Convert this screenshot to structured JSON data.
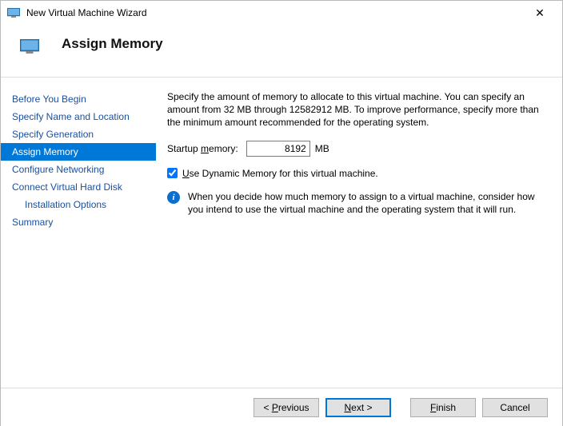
{
  "window": {
    "title": "New Virtual Machine Wizard"
  },
  "header": {
    "title": "Assign Memory"
  },
  "sidebar": {
    "items": [
      {
        "label": "Before You Begin",
        "active": false,
        "sub": false
      },
      {
        "label": "Specify Name and Location",
        "active": false,
        "sub": false
      },
      {
        "label": "Specify Generation",
        "active": false,
        "sub": false
      },
      {
        "label": "Assign Memory",
        "active": true,
        "sub": false
      },
      {
        "label": "Configure Networking",
        "active": false,
        "sub": false
      },
      {
        "label": "Connect Virtual Hard Disk",
        "active": false,
        "sub": false
      },
      {
        "label": "Installation Options",
        "active": false,
        "sub": true
      },
      {
        "label": "Summary",
        "active": false,
        "sub": false
      }
    ]
  },
  "content": {
    "description": "Specify the amount of memory to allocate to this virtual machine. You can specify an amount from 32 MB through 12582912 MB. To improve performance, specify more than the minimum amount recommended for the operating system.",
    "memory_label": "Startup memory:",
    "memory_value": "8192",
    "memory_unit": "MB",
    "dynamic_checked": true,
    "dynamic_label": "Use Dynamic Memory for this virtual machine.",
    "info_text": "When you decide how much memory to assign to a virtual machine, consider how you intend to use the virtual machine and the operating system that it will run."
  },
  "footer": {
    "previous": "< Previous",
    "next": "Next >",
    "finish": "Finish",
    "cancel": "Cancel"
  }
}
